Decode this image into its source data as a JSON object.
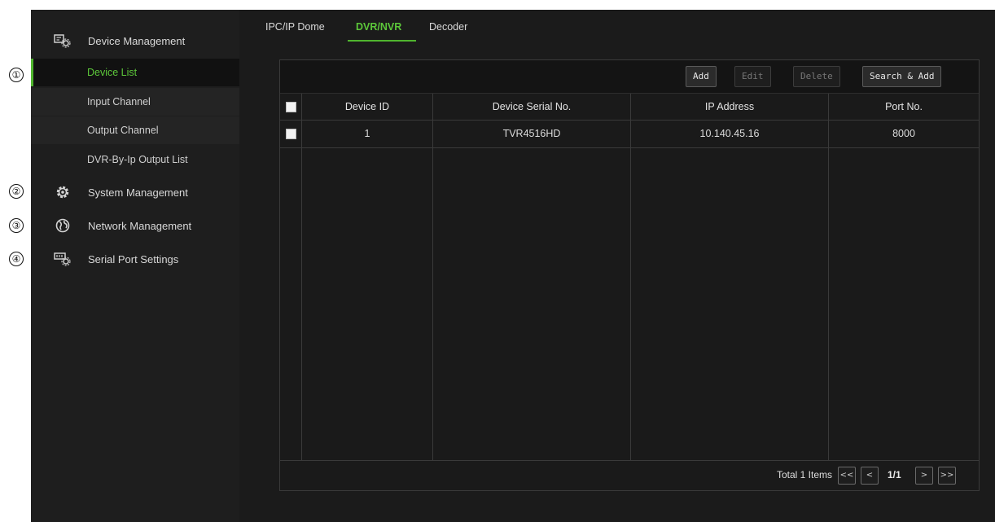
{
  "callouts": [
    "①",
    "②",
    "③",
    "④"
  ],
  "sidebar": {
    "device_management": "Device Management",
    "items": [
      {
        "label": "Device List"
      },
      {
        "label": "Input Channel"
      },
      {
        "label": "Output Channel"
      },
      {
        "label": "DVR-By-Ip Output List"
      }
    ],
    "system_management": "System Management",
    "network_management": "Network Management",
    "serial_port_settings": "Serial Port Settings"
  },
  "tabs": [
    {
      "label": "IPC/IP Dome"
    },
    {
      "label": "DVR/NVR"
    },
    {
      "label": "Decoder"
    }
  ],
  "toolbar": {
    "add": "Add",
    "edit": "Edit",
    "delete": "Delete",
    "search_add": "Search & Add"
  },
  "table": {
    "columns": [
      "Device ID",
      "Device Serial No.",
      "IP Address",
      "Port No."
    ],
    "rows": [
      {
        "device_id": "1",
        "serial": "TVR4516HD",
        "ip": "10.140.45.16",
        "port": "8000"
      }
    ]
  },
  "pagination": {
    "total": "Total 1 Items",
    "first": "<<",
    "prev": "<",
    "page": "1/1",
    "next": ">",
    "last": ">>"
  },
  "colors": {
    "accent": "#4fb52e",
    "background": "#1b1b1b"
  }
}
